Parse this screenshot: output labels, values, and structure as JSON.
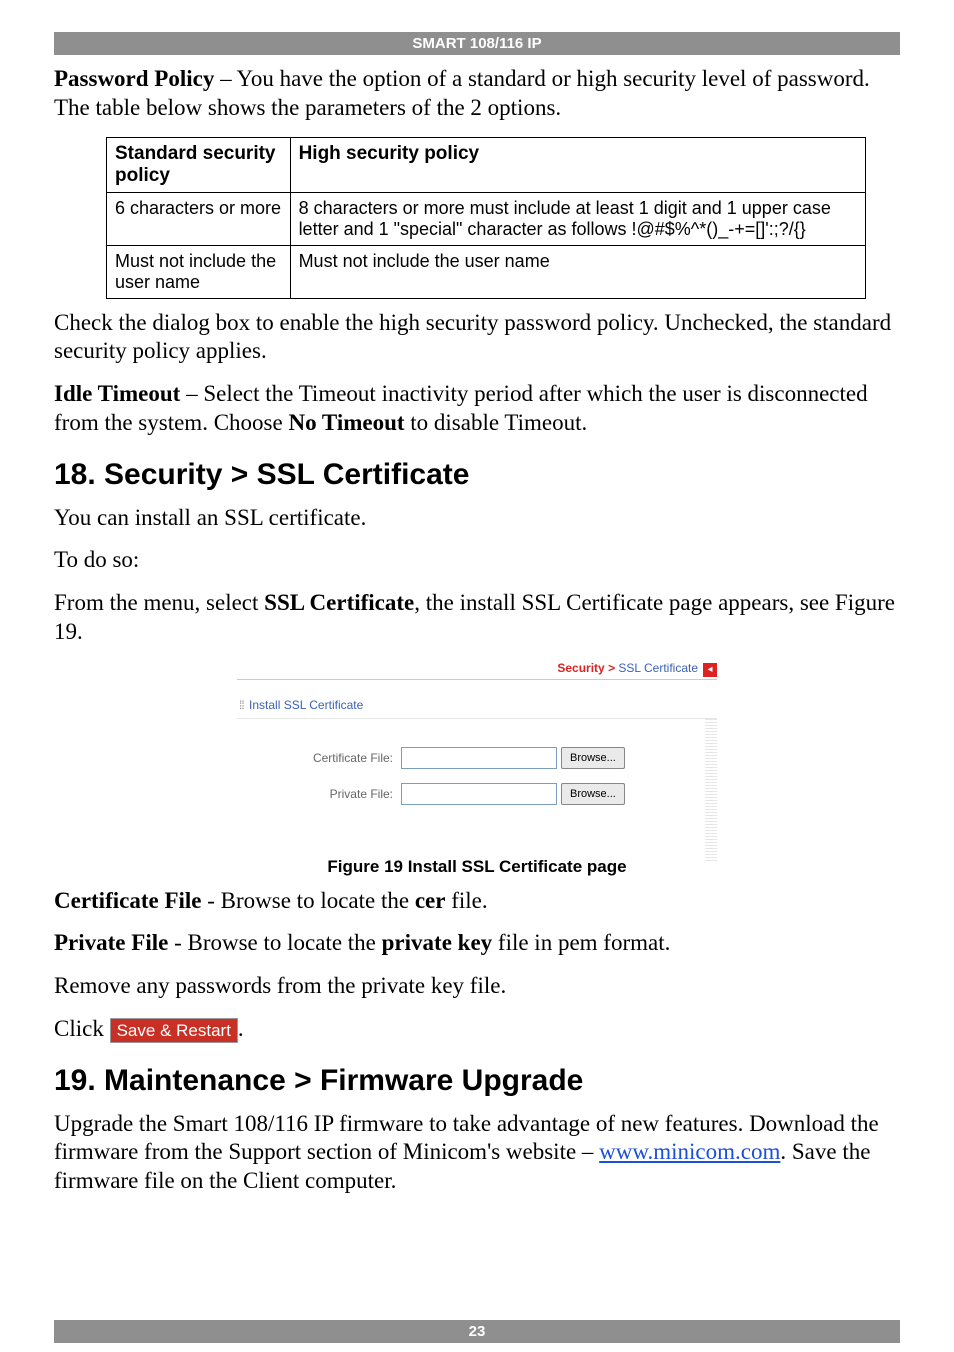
{
  "header": "SMART 108/116 IP",
  "password_policy_label": "Password Policy",
  "password_policy_text": " – You have the option of a standard or high security level of password. The table below shows the parameters of the 2 options.",
  "table": {
    "headers": {
      "standard": "Standard security policy",
      "high": "High security policy"
    },
    "rows": [
      {
        "standard": "6 characters or more",
        "high": "8 characters or more must include at least 1 digit and 1 upper case letter and 1 \"special\" character as follows !@#$%^*()_-+=[]':;?/{}"
      },
      {
        "standard": "Must not include the user name",
        "high": "Must not include the user name"
      }
    ]
  },
  "check_text": "Check the dialog box to enable the high security password policy. Unchecked, the standard security policy applies.",
  "idle_timeout_label": "Idle Timeout",
  "idle_timeout_text_pre": " – Select the Timeout inactivity period after which the user is disconnected from the system. Choose ",
  "no_timeout": "No Timeout",
  "idle_timeout_text_post": " to disable Timeout.",
  "section18": "18. Security > SSL Certificate",
  "ssl_install_text": "You can install an SSL certificate.",
  "todo_so": "To do so:",
  "from_menu_pre": "From the menu, select ",
  "ssl_cert_bold": "SSL Certificate",
  "from_menu_post": ", the install SSL Certificate page appears, see Figure 19.",
  "ssl_box": {
    "breadcrumb_sec": "Security > ",
    "breadcrumb_link": "SSL Certificate",
    "install_header": "Install SSL Certificate",
    "cert_file_label": "Certificate File:",
    "private_file_label": "Private File:",
    "browse": "Browse..."
  },
  "figure_caption": "Figure 19 Install SSL Certificate page",
  "cert_file_label": "Certificate File",
  "cert_file_text_pre": " - Browse to locate the ",
  "cer": "cer",
  "cert_file_text_post": " file.",
  "private_file_label": "Private File",
  "private_file_text_pre": " - Browse to locate the ",
  "private_key": "private key",
  "private_file_text_post": " file in pem format.",
  "remove_pw": "Remove any passwords from the private key file.",
  "click_label": "Click",
  "save_restart": "Save & Restart",
  "period": ".",
  "section19": "19. Maintenance > Firmware Upgrade",
  "upgrade_text_pre": "Upgrade the Smart 108/116 IP firmware to take advantage of new features. Download the firmware from the Support section of Minicom's website – ",
  "minicom_link": "www.minicom.com",
  "upgrade_text_post": ". Save the firmware file on the Client computer.",
  "page_number": "23"
}
